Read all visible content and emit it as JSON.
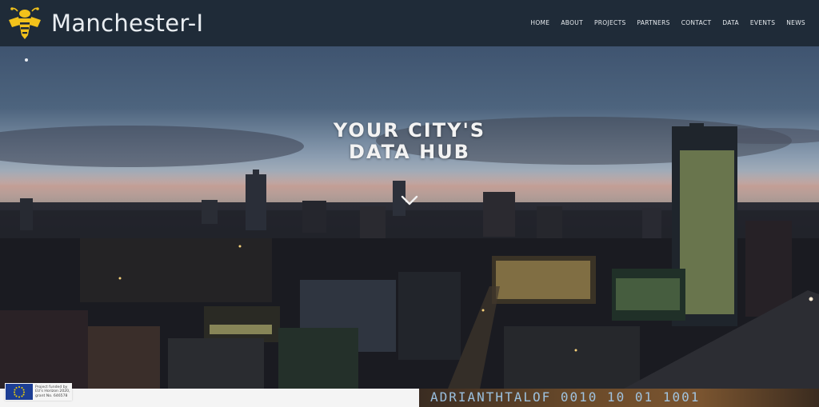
{
  "header": {
    "brand": "Manchester-I",
    "nav": [
      "HOME",
      "ABOUT",
      "PROJECTS",
      "PARTNERS",
      "CONTACT",
      "DATA",
      "EVENTS",
      "NEWS"
    ]
  },
  "hero": {
    "headline_line1": "YOUR CITY'S",
    "headline_line2": "DATA HUB"
  },
  "footer": {
    "eu_notice": [
      "Project funded by",
      "EU's Horizon 2020,",
      "grant No. 646578"
    ],
    "code_text": "ADRIANTHTALOF 0010  10  01 1001"
  },
  "icons": {
    "logo": "bee-logo-icon",
    "scroll": "chevron-down-icon",
    "flag": "eu-flag-icon"
  },
  "colors": {
    "header_bg": "#1f2b38",
    "logo_yellow": "#f2c21b",
    "text_light": "#e9edf1"
  }
}
